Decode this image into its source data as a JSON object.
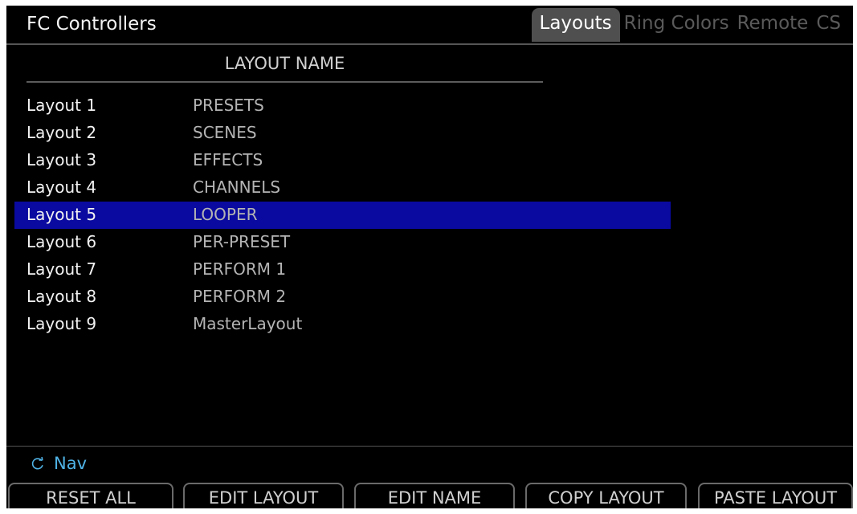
{
  "app": {
    "title": "FC Controllers"
  },
  "tabs": [
    {
      "label": "Layouts",
      "active": true
    },
    {
      "label": "Ring Colors",
      "active": false
    },
    {
      "label": "Remote",
      "active": false
    },
    {
      "label": "CS",
      "active": false
    }
  ],
  "table": {
    "header": "LAYOUT NAME",
    "selected_index": 4,
    "rows": [
      {
        "label": "Layout 1",
        "name": "PRESETS"
      },
      {
        "label": "Layout 2",
        "name": "SCENES"
      },
      {
        "label": "Layout 3",
        "name": "EFFECTS"
      },
      {
        "label": "Layout 4",
        "name": "CHANNELS"
      },
      {
        "label": "Layout 5",
        "name": "LOOPER"
      },
      {
        "label": "Layout 6",
        "name": "PER-PRESET"
      },
      {
        "label": "Layout 7",
        "name": "PERFORM 1"
      },
      {
        "label": "Layout 8",
        "name": "PERFORM 2"
      },
      {
        "label": "Layout 9",
        "name": "MasterLayout"
      }
    ]
  },
  "nav": {
    "icon": "rotate-icon",
    "label": "Nav"
  },
  "buttons": {
    "reset_all": "RESET ALL",
    "edit_layout": "EDIT LAYOUT",
    "edit_name": "EDIT NAME",
    "copy_layout": "COPY LAYOUT",
    "paste_layout": "PASTE LAYOUT"
  },
  "colors": {
    "background": "#000000",
    "selection": "#0a0aa0",
    "nav_accent": "#4fb3e6",
    "active_tab": "#4f4f4f"
  }
}
